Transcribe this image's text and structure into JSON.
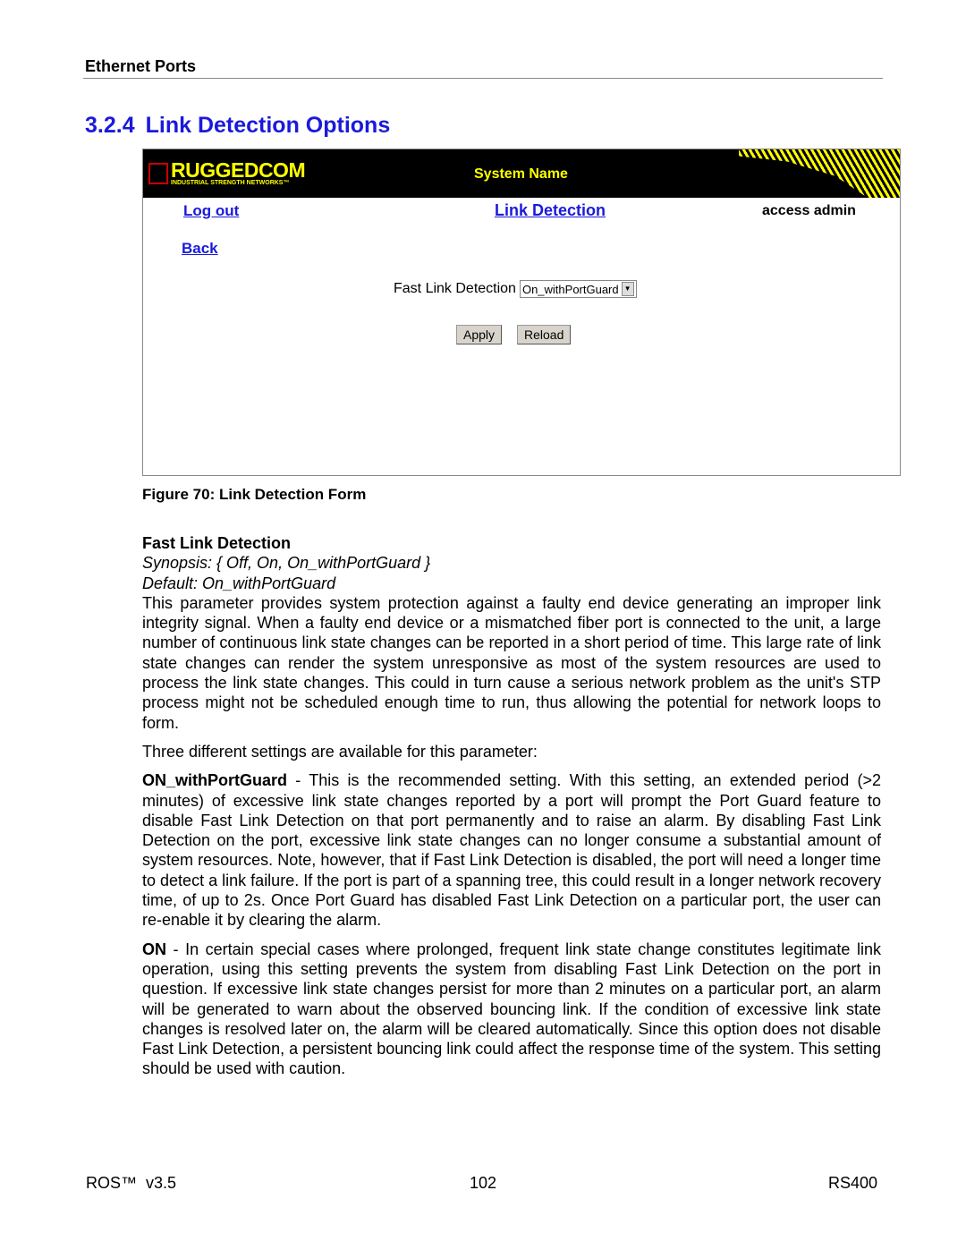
{
  "header": {
    "section_name": "Ethernet Ports"
  },
  "section": {
    "number": "3.2.4",
    "title": "Link Detection Options"
  },
  "figure": {
    "logo_text": "RUGGEDCOM",
    "logo_tagline": "INDUSTRIAL STRENGTH NETWORKS™",
    "system_name": "System Name",
    "logout": "Log out",
    "page_title": "Link Detection",
    "access": "access admin",
    "back": "Back",
    "field_label": "Fast Link Detection",
    "field_value": "On_withPortGuard",
    "apply": "Apply",
    "reload": "Reload",
    "caption": "Figure 70: Link Detection Form"
  },
  "content": {
    "param_title": "Fast Link Detection",
    "synopsis": "Synopsis: { Off, On, On_withPortGuard }",
    "default": "Default: On_withPortGuard",
    "p1": "This parameter provides system protection against a faulty end device generating an improper link integrity signal. When a faulty end device or a mismatched fiber port is connected to the unit, a large number of continuous link state changes can be reported in a short period of time. This large rate of link state changes can render the system unresponsive as most of the system resources are used to process the link state changes. This could in turn cause a serious network problem as the unit's STP process might not be scheduled enough time to run, thus allowing the potential for network loops to form.",
    "p2": " Three different settings are available for this parameter:",
    "p3_term": "ON_withPortGuard",
    "p3": " - This is the recommended setting. With this setting, an extended period (>2 minutes) of excessive link state changes reported by a port will prompt the Port Guard feature to disable Fast Link Detection on that port permanently and to raise an alarm. By disabling Fast Link Detection on the port, excessive link state changes can no longer consume a substantial amount of system resources. Note, however, that if Fast Link Detection is disabled, the port will need a longer time to detect a link failure. If the port is part of a spanning tree, this could result in a longer network recovery time, of up to 2s. Once Port Guard has disabled Fast Link Detection on a particular port, the user can re-enable it by clearing the alarm.",
    "p4_term": "ON",
    "p4": " - In certain special cases where prolonged, frequent link state change constitutes legitimate link operation, using this setting prevents the system from disabling Fast Link Detection on the port in question. If excessive link state changes persist for more than 2 minutes on a particular port, an alarm will be generated to warn about the observed bouncing link. If the condition of excessive link state changes is resolved later on, the alarm will be cleared automatically. Since this option does not disable Fast Link Detection, a persistent bouncing link could affect the response time of the system. This setting should be used with caution."
  },
  "footer": {
    "left": "ROS™  v3.5",
    "center": "102",
    "right": "RS400"
  }
}
